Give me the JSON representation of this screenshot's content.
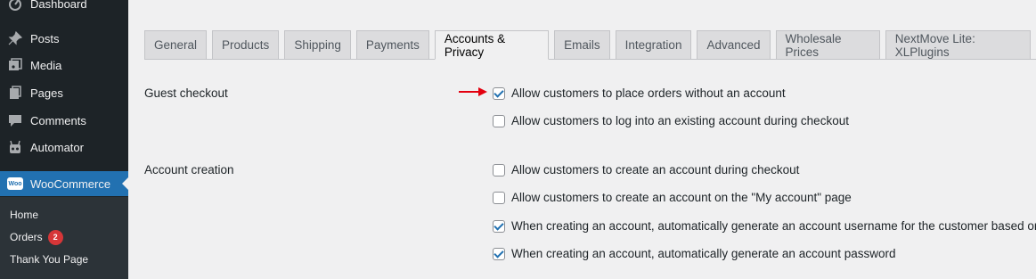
{
  "sidebar": {
    "items": [
      {
        "label": "Dashboard",
        "icon": "dashboard-icon"
      },
      {
        "label": "Posts",
        "icon": "pin-icon"
      },
      {
        "label": "Media",
        "icon": "media-icon"
      },
      {
        "label": "Pages",
        "icon": "pages-icon"
      },
      {
        "label": "Comments",
        "icon": "comments-icon"
      },
      {
        "label": "Automator",
        "icon": "robot-icon"
      },
      {
        "label": "WooCommerce",
        "icon": "woo-icon"
      }
    ],
    "woo_logo_text": "Woo",
    "submenu": [
      {
        "label": "Home"
      },
      {
        "label": "Orders",
        "badge": "2"
      },
      {
        "label": "Thank You Page"
      }
    ]
  },
  "tabs": [
    {
      "label": "General"
    },
    {
      "label": "Products"
    },
    {
      "label": "Shipping"
    },
    {
      "label": "Payments"
    },
    {
      "label": "Accounts & Privacy",
      "active": true
    },
    {
      "label": "Emails"
    },
    {
      "label": "Integration"
    },
    {
      "label": "Advanced"
    },
    {
      "label": "Wholesale Prices"
    },
    {
      "label": "NextMove Lite: XLPlugins"
    }
  ],
  "settings": {
    "guest_checkout": {
      "label": "Guest checkout",
      "options": [
        {
          "label": "Allow customers to place orders without an account",
          "checked": true
        },
        {
          "label": "Allow customers to log into an existing account during checkout",
          "checked": false
        }
      ]
    },
    "account_creation": {
      "label": "Account creation",
      "options": [
        {
          "label": "Allow customers to create an account during checkout",
          "checked": false
        },
        {
          "label": "Allow customers to create an account on the \"My account\" page",
          "checked": false
        },
        {
          "label": "When creating an account, automatically generate an account username for the customer based on their n",
          "checked": true
        },
        {
          "label": "When creating an account, automatically generate an account password",
          "checked": true
        }
      ]
    }
  },
  "colors": {
    "sidebar_bg": "#1d2327",
    "active_blue": "#2271b1",
    "badge_red": "#d63638",
    "arrow_red": "#e3000f"
  }
}
